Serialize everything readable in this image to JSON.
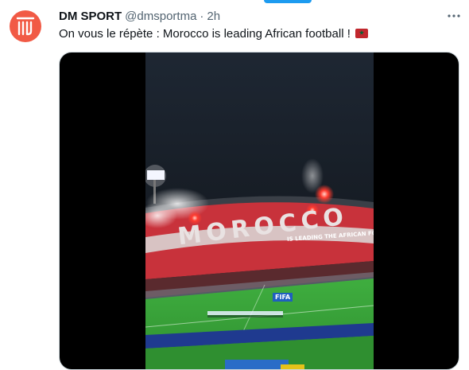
{
  "tweet": {
    "author_name": "DM SPORT",
    "handle": "@dmsportma",
    "separator": "·",
    "time": "2h",
    "text": "On vous le répète : Morocco is leading African football !",
    "flag_icon": "morocco-flag-icon",
    "more_icon": "more-options-icon"
  },
  "media": {
    "type": "video",
    "tifo_text": "MOROCCO",
    "banner_text": "IS LEADING THE AFRICAN FO",
    "board_text": "FIFA"
  },
  "colors": {
    "avatar_bg": "#f15a45",
    "accent": "#1d9bf0",
    "tifo_red": "#c8323b",
    "pitch_green": "#3aa83a"
  }
}
